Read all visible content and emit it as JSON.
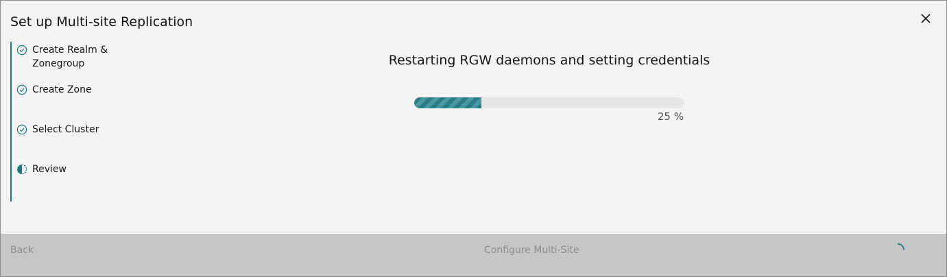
{
  "modal": {
    "title": "Set up Multi-site Replication",
    "close_icon": "close-icon"
  },
  "steps": [
    {
      "label": "Create Realm & Zonegroup",
      "status": "complete",
      "icon": "checkmark-outline-icon"
    },
    {
      "label": "Create Zone",
      "status": "complete",
      "icon": "checkmark-outline-icon"
    },
    {
      "label": "Select Cluster",
      "status": "complete",
      "icon": "checkmark-outline-icon"
    },
    {
      "label": "Review",
      "status": "current",
      "icon": "incomplete-half-icon"
    }
  ],
  "progress": {
    "title": "Restarting RGW daemons and setting credentials",
    "percent": 25,
    "percent_label": "25 %"
  },
  "footer": {
    "back_label": "Back",
    "primary_label": "Configure Multi-Site",
    "spinner_icon": "loading-spinner-icon"
  },
  "colors": {
    "accent": "#1f7a82",
    "background": "#f3f3f3",
    "footer": "#c6c6c6",
    "disabled_text": "#8d8d8d"
  }
}
